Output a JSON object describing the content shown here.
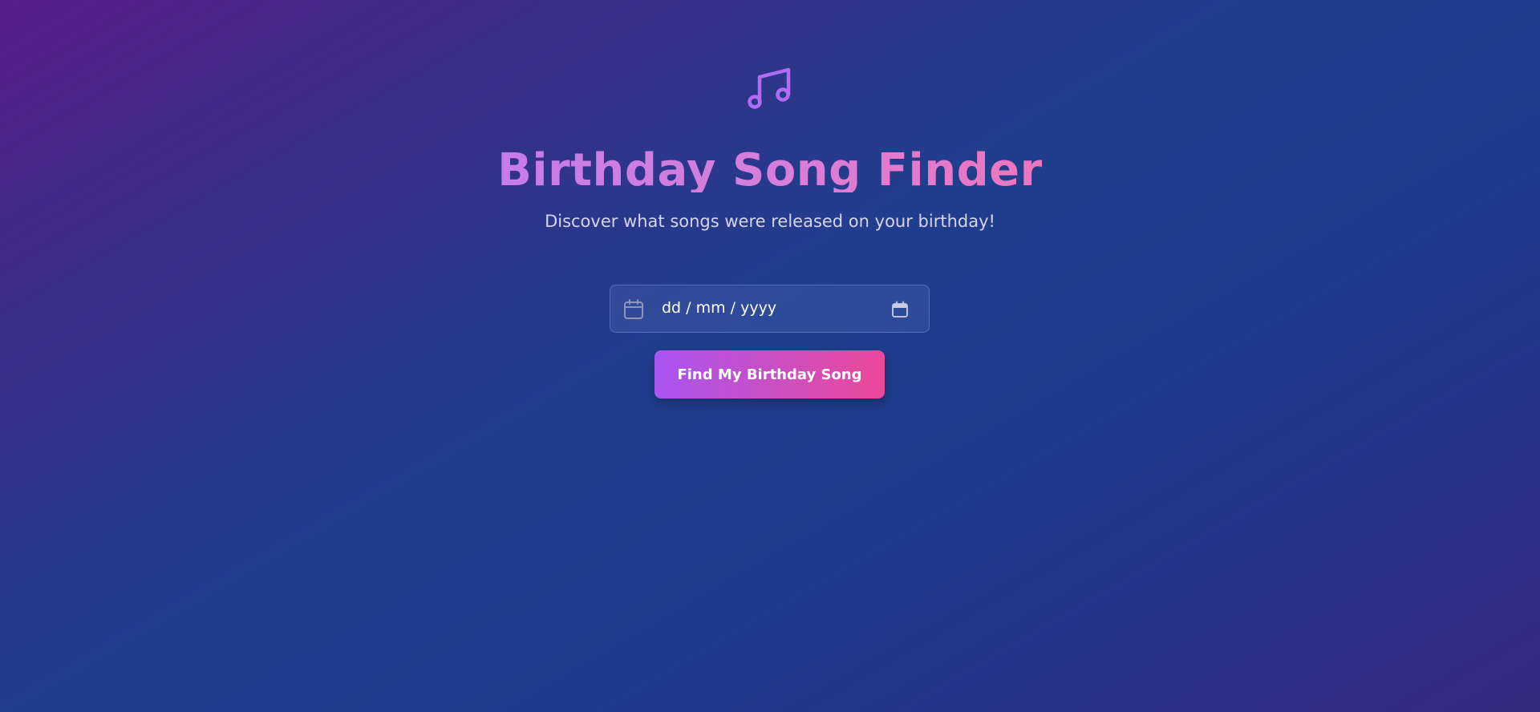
{
  "header": {
    "icon": "music-note-icon",
    "title": "Birthday Song Finder",
    "subtitle": "Discover what songs were released on your birthday!"
  },
  "date_input": {
    "lead_icon": "calendar-icon",
    "value": "dd / mm / yyyy",
    "picker_icon": "calendar-picker-icon"
  },
  "actions": {
    "find_label": "Find My Birthday Song"
  },
  "colors": {
    "accent_purple": "#a955f3",
    "accent_pink": "#ec4898",
    "icon_purple": "#b06cf2",
    "background_start": "#571d86",
    "background_mid": "#1d3a8a"
  }
}
